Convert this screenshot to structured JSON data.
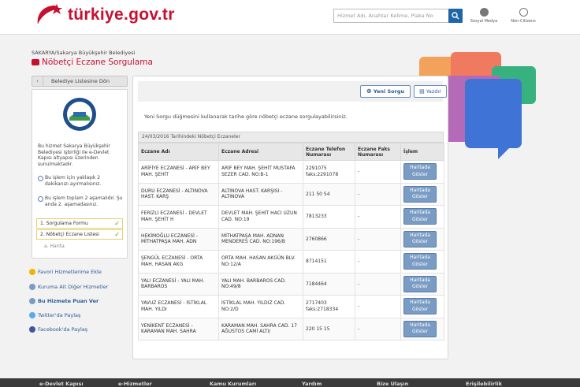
{
  "header": {
    "logo_text": "türkiye.gov.tr",
    "search_placeholder": "Hizmet Adı, Anahtar Kelime, Plaka No",
    "social_label": "Sosyal Medya",
    "noncitizens_label": "Non-Citizens"
  },
  "breadcrumb": "SAKARYA/Sakarya Büyükşehir Belediyesi",
  "page_title": "Nöbetçi Eczane Sorgulama",
  "sidebar": {
    "back_label": "Belediye Listesine Dön",
    "description": "Bu hizmet Sakarya Büyükşehir Belediyesi işbirliği ile e-Devlet Kapısı altyapısı üzerinden sunulmaktadır.",
    "note_time": "Bu işlem için yaklaşık 2 dakikanızı ayırmalısınız.",
    "note_steps": "Bu işlem toplam 2 aşamalıdır. Şu anda 2. aşamadasınız.",
    "steps": [
      "1. Sorgulama Formu",
      "2. Nöbetçi Eczane Listesi"
    ],
    "substep": "a. Harita",
    "links": [
      "Favori Hizmetlerime Ekle",
      "Kuruma Ait Diğer Hizmetler",
      "Bu Hizmete Puan Ver",
      "Twitter'da Paylaş",
      "Facebook'da Paylaş"
    ]
  },
  "main": {
    "new_query_label": "Yeni Sorgu",
    "print_label": "Yazdır",
    "instruction": "Yeni Sorgu düğmesini kullanarak tarihe göre nöbetçi eczane sorgulayabilirsiniz.",
    "table_caption": "24/03/2016 Tarihindeki Nöbetçi Eczaneler",
    "columns": [
      "Eczane Adı",
      "Eczane Adresi",
      "Eczane Telefon Numarası",
      "Eczane Faks Numarası",
      "İşlem"
    ],
    "map_button_label": "Haritada Göster",
    "rows": [
      {
        "name": "ARİFİYE ECZANESİ - ARİF BEY MAH. ŞEHİT",
        "address": "ARİF BEY MAH. ŞEHİT MUSTAFA SEZER CAD. NO:B-1",
        "phone": "2291075 faks:2291078",
        "fax": "-"
      },
      {
        "name": "DURU ECZANESİ - ALTINOVA HAST. KARŞ",
        "address": "ALTINOVA HAST. KARŞISI - ALTINOVA",
        "phone": "211 50 54",
        "fax": "-"
      },
      {
        "name": "FERİZLİ ECZANESİ - DEVLET MAH. ŞEHİT H",
        "address": "DEVLET MAH. ŞEHİT HACI UZUN CAD. NO:19",
        "phone": "7813233",
        "fax": "-"
      },
      {
        "name": "HEKİMOĞLU ECZANESİ - MİTHATPAŞA MAH. ADN",
        "address": "MİTHATPAŞA MAH. ADNAN MENDERES CAD. NO:196/B",
        "phone": "2760866",
        "fax": "-"
      },
      {
        "name": "ŞENGÜL ECZANESİ - ORTA MAH. HASAN AKG",
        "address": "ORTA MAH. HASAN AKGÜN BLV. NO:12/A",
        "phone": "8714151",
        "fax": "-"
      },
      {
        "name": "YALI ECZANESİ - YALI MAH. BARBAROS",
        "address": "YALI MAH. BARBAROS CAD. NO:49/8",
        "phone": "7184464",
        "fax": "-"
      },
      {
        "name": "YAVUZ ECZANESİ - İSTİKLAL MAH. YILDI",
        "address": "İSTİKLAL MAH. YILDIZ CAD. NO:2/D",
        "phone": "2717403 faks:2718334",
        "fax": "-"
      },
      {
        "name": "YENİKENT ECZANESİ - KARAMAN MAH. SAHRA",
        "address": "KARAMAN MAH. SAHRA CAD. 17 AĞUSTOS CAMİ ALTI/",
        "phone": "220 15 15",
        "fax": "-"
      }
    ]
  },
  "footer": [
    "e-Devlet Kapısı",
    "e-Hizmetler",
    "Kamu Kurumları",
    "Yardım",
    "Bize Ulaşın",
    "Erişilebilirlik"
  ],
  "colors": {
    "brand_red": "#c8102e",
    "link_blue": "#2a5a96",
    "button_blue": "#7a9cc4"
  }
}
